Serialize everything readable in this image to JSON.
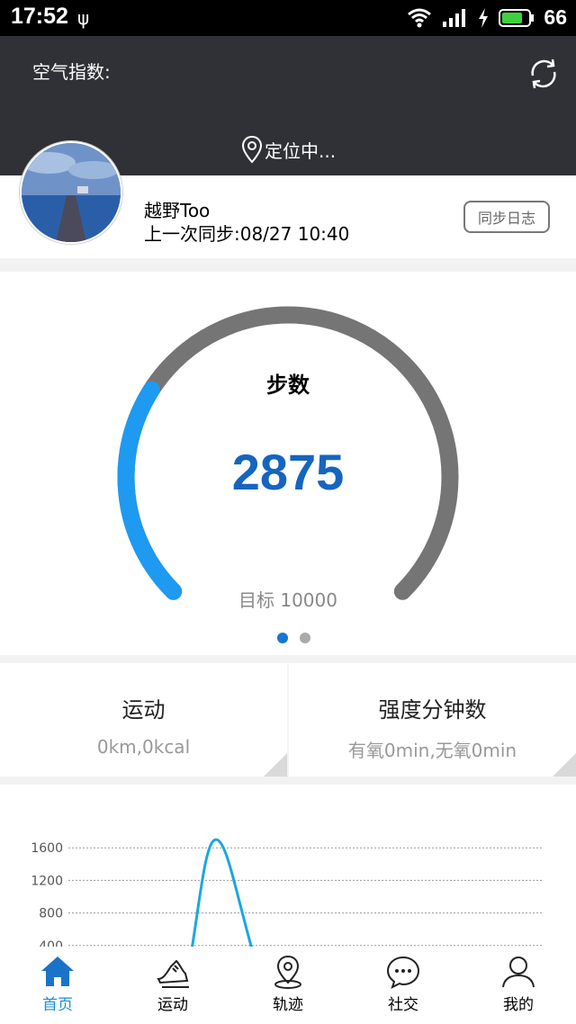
{
  "status_bar": {
    "time": "17:52",
    "battery": "66"
  },
  "header": {
    "air_index_label": "空气指数:",
    "location_text": "定位中..."
  },
  "profile": {
    "name": "越野Too",
    "last_sync": "上一次同步:08/27 10:40",
    "sync_button": "同步日志"
  },
  "gauge": {
    "title": "步数",
    "steps": "2875",
    "goal_text": "目标 10000",
    "steps_value": 2875,
    "goal_value": 10000,
    "page_count": 2,
    "active_page": 0,
    "active_color": "#1976d2",
    "track_color": "#757575",
    "progress_color": "#1e9af0"
  },
  "stats": [
    {
      "title": "运动",
      "subtitle": "0km,0kcal"
    },
    {
      "title": "强度分钟数",
      "subtitle": "有氧0min,无氧0min"
    }
  ],
  "chart_data": {
    "type": "line",
    "ylabel": "",
    "y_ticks": [
      "1600",
      "1200",
      "800",
      "400"
    ],
    "ylim": [
      0,
      1800
    ],
    "peak_value": 1700,
    "grid": "dotted horizontal",
    "line_color": "#1aa7e0"
  },
  "nav": [
    {
      "label": "首页",
      "icon": "home-icon",
      "active": true
    },
    {
      "label": "运动",
      "icon": "running-shoe-icon",
      "active": false
    },
    {
      "label": "轨迹",
      "icon": "map-pin-icon",
      "active": false
    },
    {
      "label": "社交",
      "icon": "chat-bubble-icon",
      "active": false
    },
    {
      "label": "我的",
      "icon": "user-icon",
      "active": false
    }
  ]
}
